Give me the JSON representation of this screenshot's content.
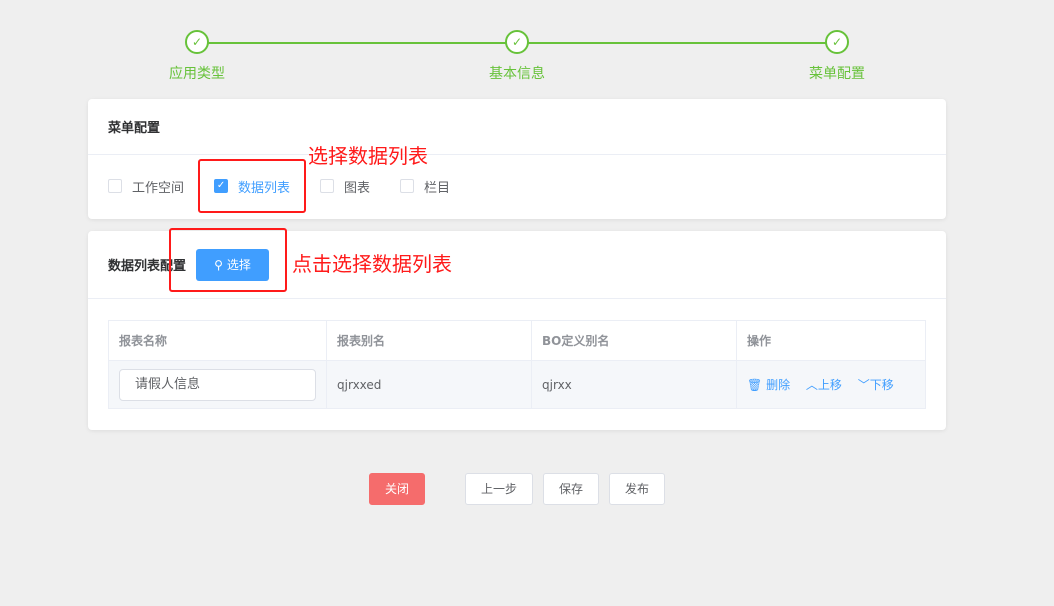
{
  "steps": [
    {
      "label": "应用类型"
    },
    {
      "label": "基本信息"
    },
    {
      "label": "菜单配置"
    }
  ],
  "menu_config": {
    "title": "菜单配置",
    "options": [
      {
        "label": "工作空间",
        "checked": false
      },
      {
        "label": "数据列表",
        "checked": true
      },
      {
        "label": "图表",
        "checked": false
      },
      {
        "label": "栏目",
        "checked": false
      }
    ]
  },
  "list_config": {
    "title": "数据列表配置",
    "select_label": "选择",
    "columns": [
      "报表名称",
      "报表别名",
      "BO定义别名",
      "操作"
    ],
    "rows": [
      {
        "name": "请假人信息",
        "alias": "qjrxxed",
        "bo_alias": "qjrxx",
        "actions": {
          "delete": "删除",
          "up": "上移",
          "down": "下移"
        }
      }
    ]
  },
  "annotations": {
    "a1": "选择数据列表",
    "a2": "点击选择数据列表"
  },
  "footer": {
    "close": "关闭",
    "prev": "上一步",
    "save": "保存",
    "publish": "发布"
  }
}
